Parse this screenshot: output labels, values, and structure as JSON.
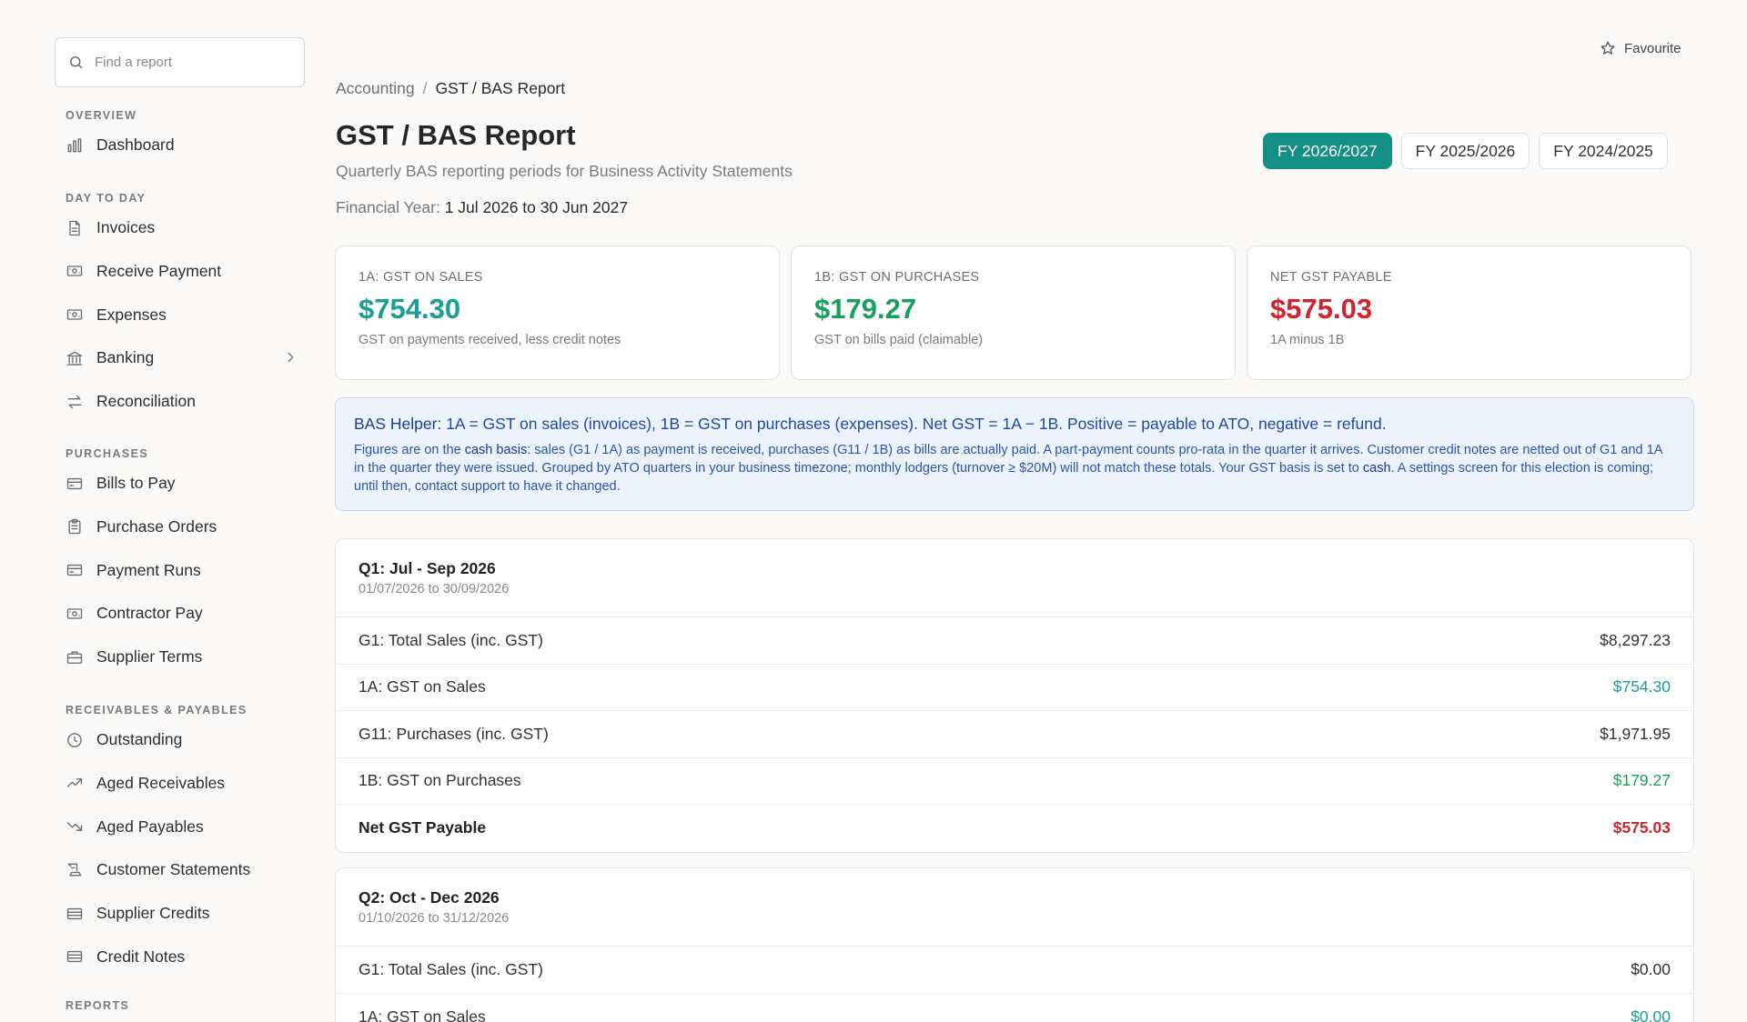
{
  "search": {
    "placeholder": "Find a report"
  },
  "favourite_label": "Favourite",
  "sidebar": {
    "sections": [
      {
        "title": "OVERVIEW",
        "items": [
          {
            "label": "Dashboard",
            "icon": "bar-chart-icon"
          }
        ]
      },
      {
        "title": "DAY TO DAY",
        "items": [
          {
            "label": "Invoices",
            "icon": "document-icon"
          },
          {
            "label": "Receive Payment",
            "icon": "banknote-icon"
          },
          {
            "label": "Expenses",
            "icon": "banknote-icon"
          },
          {
            "label": "Banking",
            "icon": "bank-icon",
            "has_submenu": true
          },
          {
            "label": "Reconciliation",
            "icon": "arrows-swap-icon"
          }
        ]
      },
      {
        "title": "PURCHASES",
        "items": [
          {
            "label": "Bills to Pay",
            "icon": "credit-card-icon"
          },
          {
            "label": "Purchase Orders",
            "icon": "clipboard-icon"
          },
          {
            "label": "Payment Runs",
            "icon": "credit-card-icon"
          },
          {
            "label": "Contractor Pay",
            "icon": "banknote-icon"
          },
          {
            "label": "Supplier Terms",
            "icon": "briefcase-icon"
          }
        ]
      },
      {
        "title": "RECEIVABLES & PAYABLES",
        "items": [
          {
            "label": "Outstanding",
            "icon": "clock-icon"
          },
          {
            "label": "Aged Receivables",
            "icon": "trending-up-icon"
          },
          {
            "label": "Aged Payables",
            "icon": "trending-down-icon"
          },
          {
            "label": "Customer Statements",
            "icon": "receipt-icon"
          },
          {
            "label": "Supplier Credits",
            "icon": "list-card-icon"
          },
          {
            "label": "Credit Notes",
            "icon": "list-card-icon"
          }
        ]
      },
      {
        "title": "REPORTS",
        "items": []
      }
    ]
  },
  "breadcrumb": {
    "parent": "Accounting",
    "separator": "/",
    "current": "GST / BAS Report"
  },
  "page": {
    "title": "GST / BAS Report",
    "subtitle": "Quarterly BAS reporting periods for Business Activity Statements",
    "fy_label": "Financial Year:",
    "fy_value": "1 Jul 2026 to 30 Jun 2027"
  },
  "fy_tabs": [
    {
      "label": "FY 2026/2027",
      "active": true
    },
    {
      "label": "FY 2025/2026",
      "active": false
    },
    {
      "label": "FY 2024/2025",
      "active": false
    }
  ],
  "summary_cards": [
    {
      "label": "1A: GST ON SALES",
      "value": "$754.30",
      "note": "GST on payments received, less credit notes",
      "color": "#1a9e95"
    },
    {
      "label": "1B: GST ON PURCHASES",
      "value": "$179.27",
      "note": "GST on bills paid (claimable)",
      "color": "#17a05a"
    },
    {
      "label": "NET GST PAYABLE",
      "value": "$575.03",
      "note": "1A minus 1B",
      "color": "#d1252e"
    }
  ],
  "helper": {
    "lead_bold": "BAS Helper:",
    "lead_text": " 1A = GST on sales (invoices), 1B = GST on purchases (expenses). Net GST = 1A − 1B. Positive = payable to ATO, negative = refund.",
    "d1": "Figures are on the ",
    "d_bold1": "cash basis",
    "d2": ": sales (G1 / 1A) as payment is received, purchases (G11 / 1B) as bills are actually paid. A part-payment counts pro-rata in the quarter it arrives. Customer credit notes are netted out of G1 and 1A in the quarter they were issued. Grouped by ATO quarters in your business timezone; monthly lodgers (turnover ≥ $20M) will not match these totals. Your GST basis is set to ",
    "d_bold2": "cash",
    "d3": ". A settings screen for this election is coming; until then, contact support to have it changed."
  },
  "quarters": [
    {
      "title": "Q1: Jul - Sep 2026",
      "dates": "01/07/2026 to 30/09/2026",
      "rows": [
        {
          "label": "G1: Total Sales (inc. GST)",
          "value": "$8,297.23",
          "tone": ""
        },
        {
          "label": "1A: GST on Sales",
          "value": "$754.30",
          "tone": "teal"
        },
        {
          "label": "G11: Purchases (inc. GST)",
          "value": "$1,971.95",
          "tone": ""
        },
        {
          "label": "1B: GST on Purchases",
          "value": "$179.27",
          "tone": "green"
        },
        {
          "label": "Net GST Payable",
          "value": "$575.03",
          "tone": "red",
          "total": true
        }
      ]
    },
    {
      "title": "Q2: Oct - Dec 2026",
      "dates": "01/10/2026 to 31/12/2026",
      "rows": [
        {
          "label": "G1: Total Sales (inc. GST)",
          "value": "$0.00",
          "tone": ""
        },
        {
          "label": "1A: GST on Sales",
          "value": "$0.00",
          "tone": "teal"
        }
      ]
    }
  ],
  "colors": {
    "accent": "#138f86",
    "sales": "#1a9e95",
    "purchases": "#17a05a",
    "payable": "#d1252e",
    "helper_bg": "#edf3fd"
  }
}
